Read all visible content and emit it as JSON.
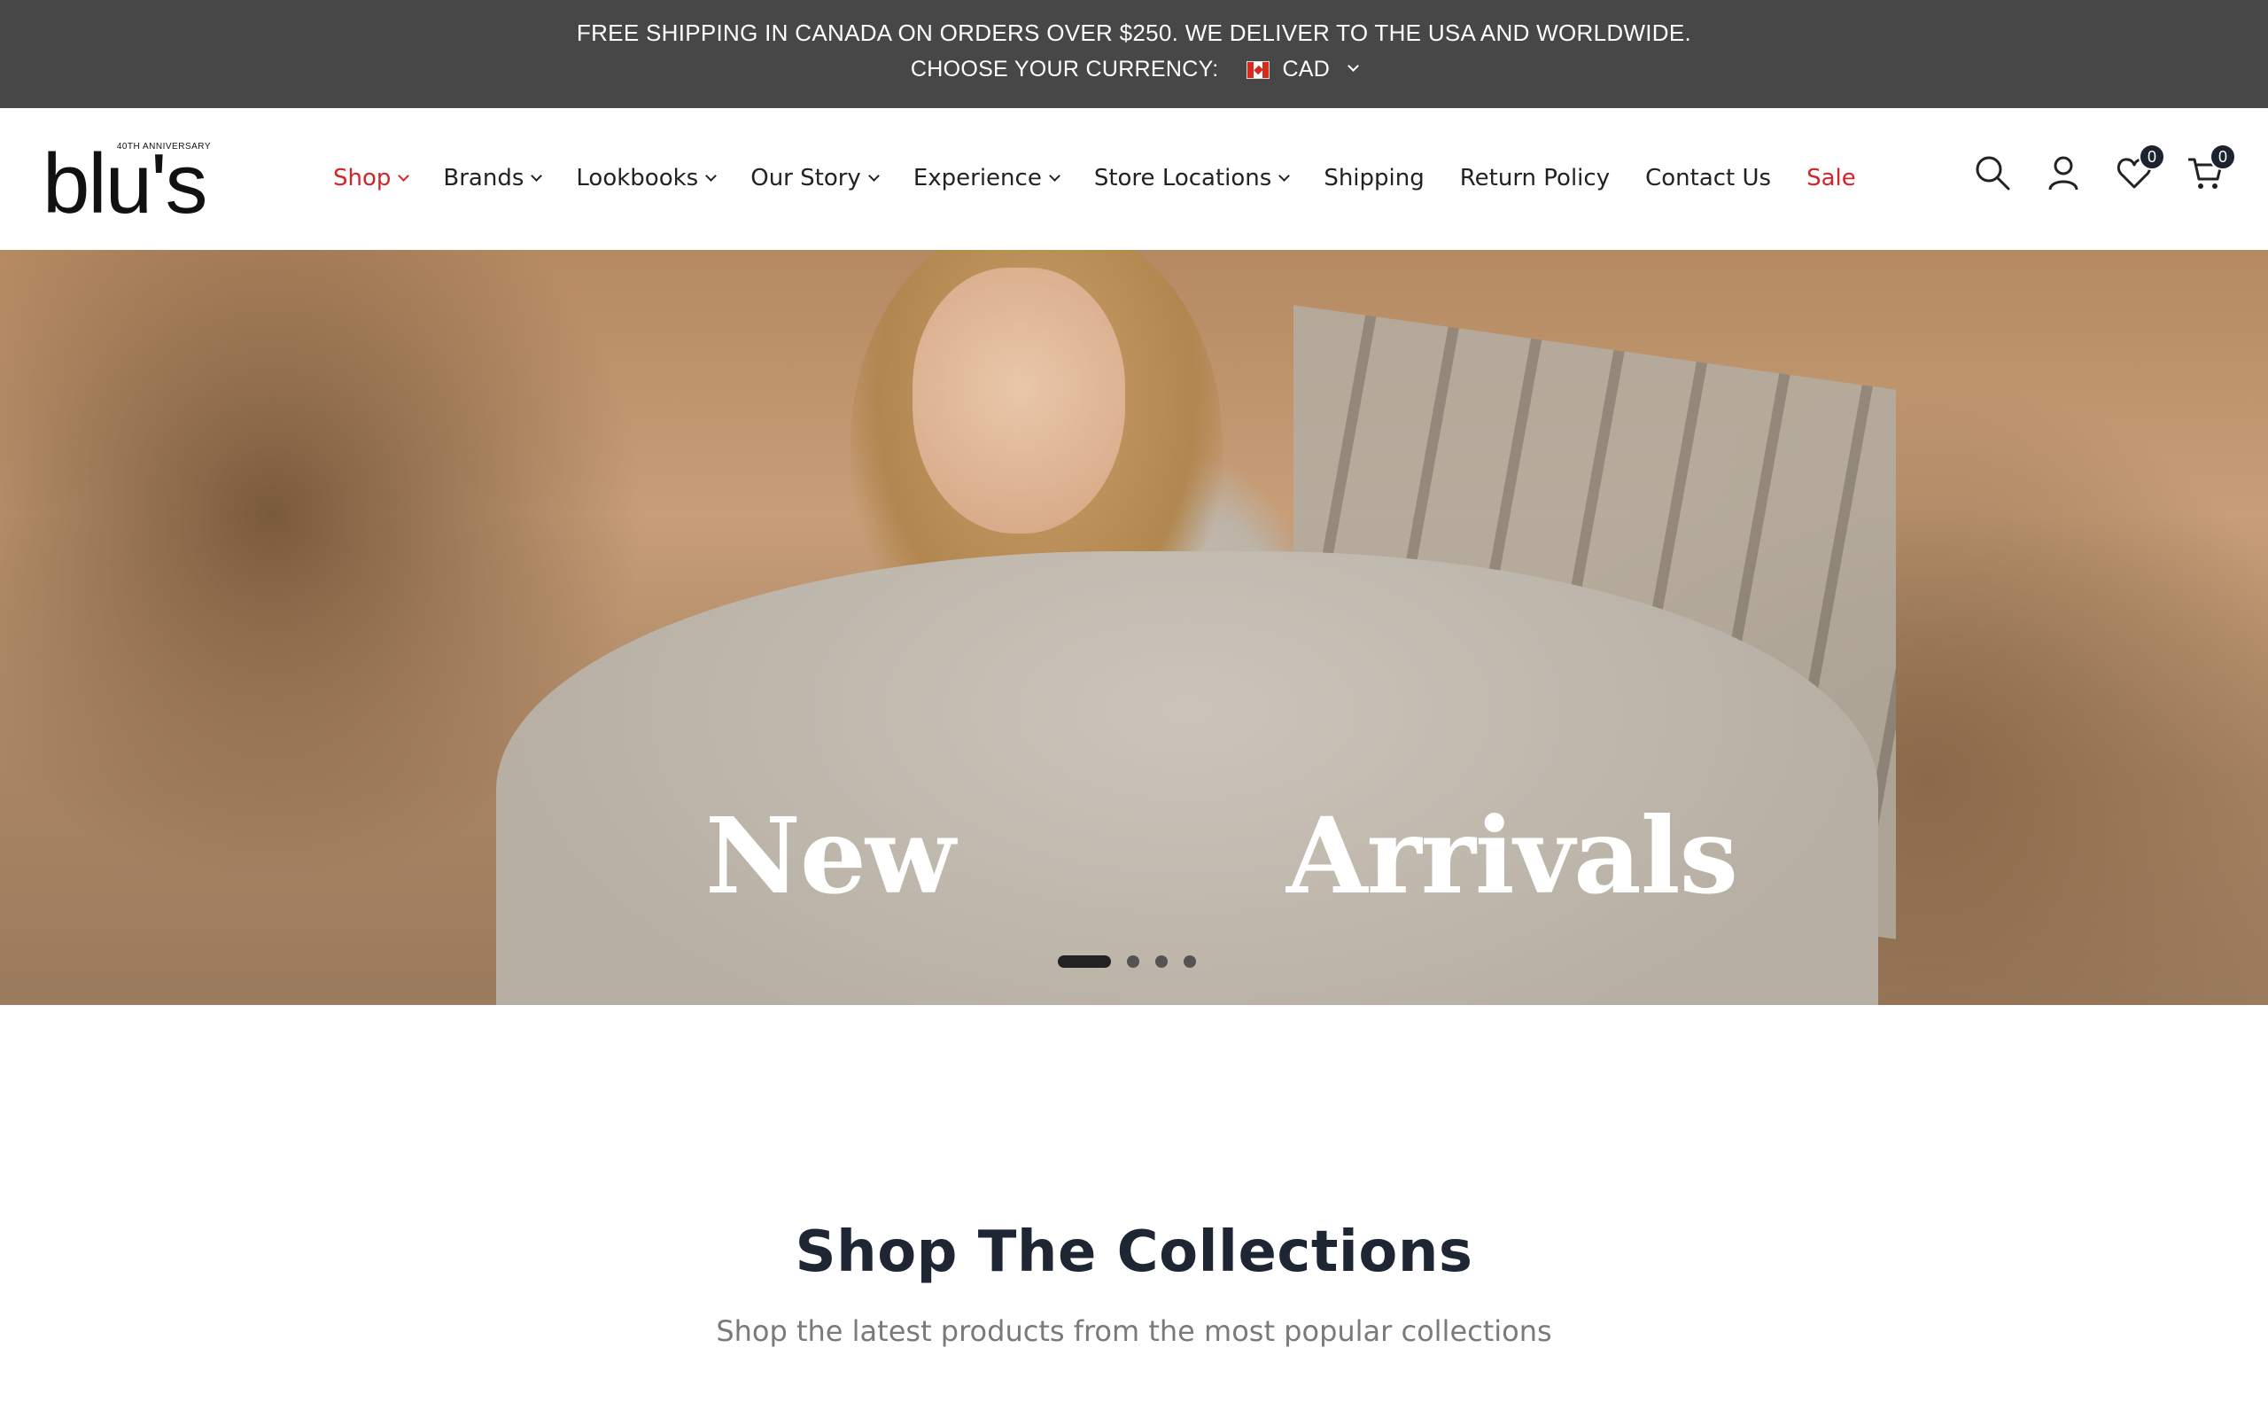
{
  "announcement": {
    "line1": "FREE SHIPPING IN CANADA ON ORDERS OVER $250. WE DELIVER TO THE USA AND WORLDWIDE.",
    "currency_label": "CHOOSE YOUR CURRENCY:",
    "currency_value": "CAD"
  },
  "logo": {
    "wordmark": "blu's",
    "anniversary": "40TH ANNIVERSARY"
  },
  "nav": {
    "items": [
      {
        "label": "Shop"
      },
      {
        "label": "Brands"
      },
      {
        "label": "Lookbooks"
      },
      {
        "label": "Our Story"
      },
      {
        "label": "Experience"
      },
      {
        "label": "Store Locations"
      },
      {
        "label": "Shipping"
      },
      {
        "label": "Return Policy"
      },
      {
        "label": "Contact Us"
      },
      {
        "label": "Sale"
      }
    ]
  },
  "header_icons": {
    "wishlist_count": "0",
    "cart_count": "0"
  },
  "hero": {
    "word1": "New",
    "word2": "Arrivals",
    "slides": 4,
    "active_slide": 1
  },
  "collections": {
    "title": "Shop The Collections",
    "subtitle": "Shop the latest products from the most popular collections"
  },
  "colors": {
    "announcement_bg": "#474747",
    "accent_red": "#d4242a",
    "badge_bg": "#1d2230"
  }
}
